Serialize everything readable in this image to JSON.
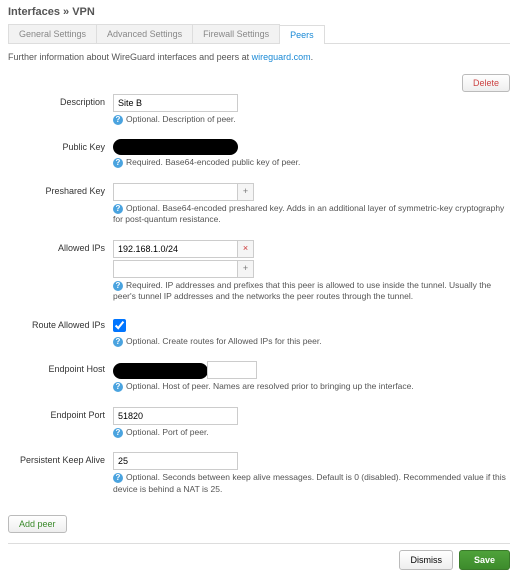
{
  "breadcrumb": "Interfaces » VPN",
  "tabs": {
    "general": "General Settings",
    "advanced": "Advanced Settings",
    "firewall": "Firewall Settings",
    "peers": "Peers"
  },
  "intro": {
    "prefix": "Further information about WireGuard interfaces and peers at ",
    "link": "wireguard.com",
    "suffix": "."
  },
  "buttons": {
    "delete": "Delete",
    "add_peer": "Add peer",
    "dismiss": "Dismiss",
    "save": "Save"
  },
  "labels": {
    "description": "Description",
    "public_key": "Public Key",
    "preshared_key": "Preshared Key",
    "allowed_ips": "Allowed IPs",
    "route_allowed": "Route Allowed IPs",
    "endpoint_host": "Endpoint Host",
    "endpoint_port": "Endpoint Port",
    "keep_alive": "Persistent Keep Alive"
  },
  "values": {
    "description": "Site B",
    "allowed_ip_1": "192.168.1.0/24",
    "allowed_ip_2": "",
    "route_allowed": true,
    "endpoint_port": "51820",
    "keep_alive": "25",
    "preshared_key": ""
  },
  "help": {
    "description": "Optional. Description of peer.",
    "public_key": "Required. Base64-encoded public key of peer.",
    "preshared_key": "Optional. Base64-encoded preshared key. Adds in an additional layer of symmetric-key cryptography for post-quantum resistance.",
    "allowed_ips": "Required. IP addresses and prefixes that this peer is allowed to use inside the tunnel. Usually the peer's tunnel IP addresses and the networks the peer routes through the tunnel.",
    "route_allowed": "Optional. Create routes for Allowed IPs for this peer.",
    "endpoint_host": "Optional. Host of peer. Names are resolved prior to bringing up the interface.",
    "endpoint_port": "Optional. Port of peer.",
    "keep_alive": "Optional. Seconds between keep alive messages. Default is 0 (disabled). Recommended value if this device is behind a NAT is 25."
  }
}
